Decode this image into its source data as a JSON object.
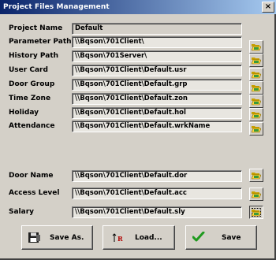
{
  "window": {
    "title": "Project Files Management",
    "close_label": "×"
  },
  "fields": [
    {
      "label": "Project Name",
      "value": "Default"
    },
    {
      "label": "Parameter Path",
      "value": "\\\\Bqson\\701Client\\"
    },
    {
      "label": "History Path",
      "value": "\\\\Bqson\\701Server\\"
    },
    {
      "label": "User Card",
      "value": "\\\\Bqson\\701Client\\Default.usr"
    },
    {
      "label": "Door Group",
      "value": "\\\\Bqson\\701Client\\Default.grp"
    },
    {
      "label": "Time Zone",
      "value": "\\\\Bqson\\701Client\\Default.zon"
    },
    {
      "label": "Holiday",
      "value": "\\\\Bqson\\701Client\\Default.hol"
    },
    {
      "label": "Attendance",
      "value": "\\\\Bqson\\701Client\\Default.wrkName"
    },
    {
      "label": "Door Name",
      "value": "\\\\Bqson\\701Client\\Default.dor"
    },
    {
      "label": "Access Level",
      "value": "\\\\Bqson\\701Client\\Default.acc"
    },
    {
      "label": "Salary",
      "value": "\\\\Bqson\\701Client\\Default.sly"
    }
  ],
  "buttons": {
    "save_as": "Save As.",
    "load": "Load...",
    "save": "Save"
  },
  "icons": {
    "browse": "folder-open-icon",
    "save_as": "floppy-icon",
    "load": "load-file-icon",
    "save": "checkmark-icon"
  }
}
